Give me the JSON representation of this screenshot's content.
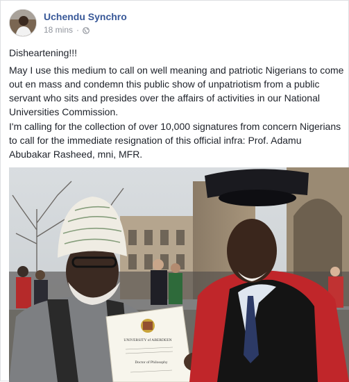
{
  "post": {
    "author": "Uchendu Synchro",
    "time": "18 mins",
    "separator": "·",
    "privacy_icon": "globe-icon",
    "paragraphs": [
      "Disheartening!!!",
      "May I use this medium to call on well meaning and patriotic Nigerians to come out en mass and condemn this public show of unpatriotism from a public servant who sits and presides over the affairs of activities in our National Universities Commission.",
      "I'm calling for the collection of over 10,000 signatures from concern Nigerians to call for the immediate resignation of this official infra: Prof. Adamu Abubakar Rasheed, mni, MFR."
    ],
    "photo": {
      "certificate_heading": "UNIVERSITY of ABERDEEN",
      "certificate_degree": "Doctor of Philosophy"
    }
  },
  "colors": {
    "author_link": "#385898",
    "meta_gray": "#90949c",
    "text": "#1d2129"
  }
}
